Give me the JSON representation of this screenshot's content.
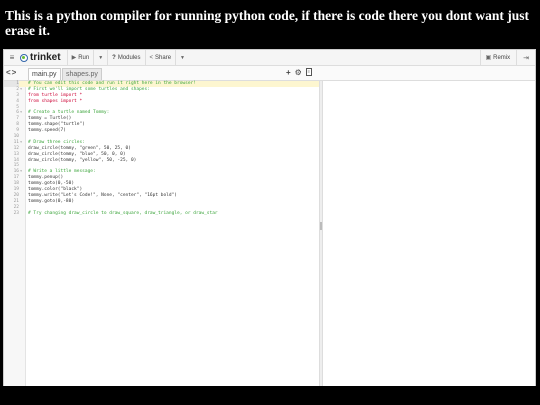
{
  "banner": {
    "text": "This is a python compiler for running python code, if there is code there you dont want just erase it."
  },
  "toolbar": {
    "logo_text": "trinket",
    "run_label": "Run",
    "modules_label": "Modules",
    "share_label": "Share",
    "remix_label": "Remix"
  },
  "tabs": [
    {
      "label": "main.py",
      "active": true
    },
    {
      "label": "shapes.py",
      "active": false
    }
  ],
  "code_lines": [
    {
      "n": "1",
      "fold": "",
      "text": "# You can edit this code and run it right here in the browser!",
      "kind": "comment",
      "active": true
    },
    {
      "n": "2",
      "fold": "▾",
      "text": "# First we'll import some turtles and shapes:",
      "kind": "comment",
      "active": false
    },
    {
      "n": "3",
      "fold": "",
      "text": "from turtle import *",
      "kind": "kw",
      "active": false
    },
    {
      "n": "4",
      "fold": "",
      "text": "from shapes import *",
      "kind": "kw",
      "active": false
    },
    {
      "n": "5",
      "fold": "",
      "text": "",
      "kind": "plain",
      "active": false
    },
    {
      "n": "6",
      "fold": "▾",
      "text": "# Create a turtle named Tommy:",
      "kind": "comment",
      "active": false
    },
    {
      "n": "7",
      "fold": "",
      "text": "tommy = Turtle()",
      "kind": "plain",
      "active": false
    },
    {
      "n": "8",
      "fold": "",
      "text": "tommy.shape(\"turtle\")",
      "kind": "plain",
      "active": false
    },
    {
      "n": "9",
      "fold": "",
      "text": "tommy.speed(7)",
      "kind": "plain",
      "active": false
    },
    {
      "n": "10",
      "fold": "",
      "text": "",
      "kind": "plain",
      "active": false
    },
    {
      "n": "11",
      "fold": "▾",
      "text": "# Draw three circles:",
      "kind": "comment",
      "active": false
    },
    {
      "n": "12",
      "fold": "",
      "text": "draw_circle(tommy, \"green\", 50, 25, 0)",
      "kind": "plain",
      "active": false
    },
    {
      "n": "13",
      "fold": "",
      "text": "draw_circle(tommy, \"blue\", 50, 0, 0)",
      "kind": "plain",
      "active": false
    },
    {
      "n": "14",
      "fold": "",
      "text": "draw_circle(tommy, \"yellow\", 50, -25, 0)",
      "kind": "plain",
      "active": false
    },
    {
      "n": "15",
      "fold": "",
      "text": "",
      "kind": "plain",
      "active": false
    },
    {
      "n": "16",
      "fold": "▾",
      "text": "# Write a little message:",
      "kind": "comment",
      "active": false
    },
    {
      "n": "17",
      "fold": "",
      "text": "tommy.penup()",
      "kind": "plain",
      "active": false
    },
    {
      "n": "18",
      "fold": "",
      "text": "tommy.goto(0,-50)",
      "kind": "plain",
      "active": false
    },
    {
      "n": "19",
      "fold": "",
      "text": "tommy.color(\"black\")",
      "kind": "plain",
      "active": false
    },
    {
      "n": "20",
      "fold": "",
      "text": "tommy.write(\"Let's Code!\", None, \"center\", \"16pt bold\")",
      "kind": "plain",
      "active": false
    },
    {
      "n": "21",
      "fold": "",
      "text": "tommy.goto(0,-80)",
      "kind": "plain",
      "active": false
    },
    {
      "n": "22",
      "fold": "",
      "text": "",
      "kind": "plain",
      "active": false
    },
    {
      "n": "23",
      "fold": "",
      "text": "# Try changing draw_circle to draw_square, draw_triangle, or draw_star",
      "kind": "comment",
      "active": false
    }
  ],
  "icons": {
    "menu": "hamburger-icon",
    "run": "play-icon",
    "modules": "question-icon",
    "share": "share-icon",
    "remix": "remix-icon",
    "signin": "signin-icon",
    "add_file": "plus-icon",
    "settings": "gear-icon",
    "page": "page-icon"
  },
  "colors": {
    "comment": "#39a339",
    "keyword": "#cc0033",
    "logo_green": "#66bb33",
    "active_line": "#fdf6d0"
  }
}
